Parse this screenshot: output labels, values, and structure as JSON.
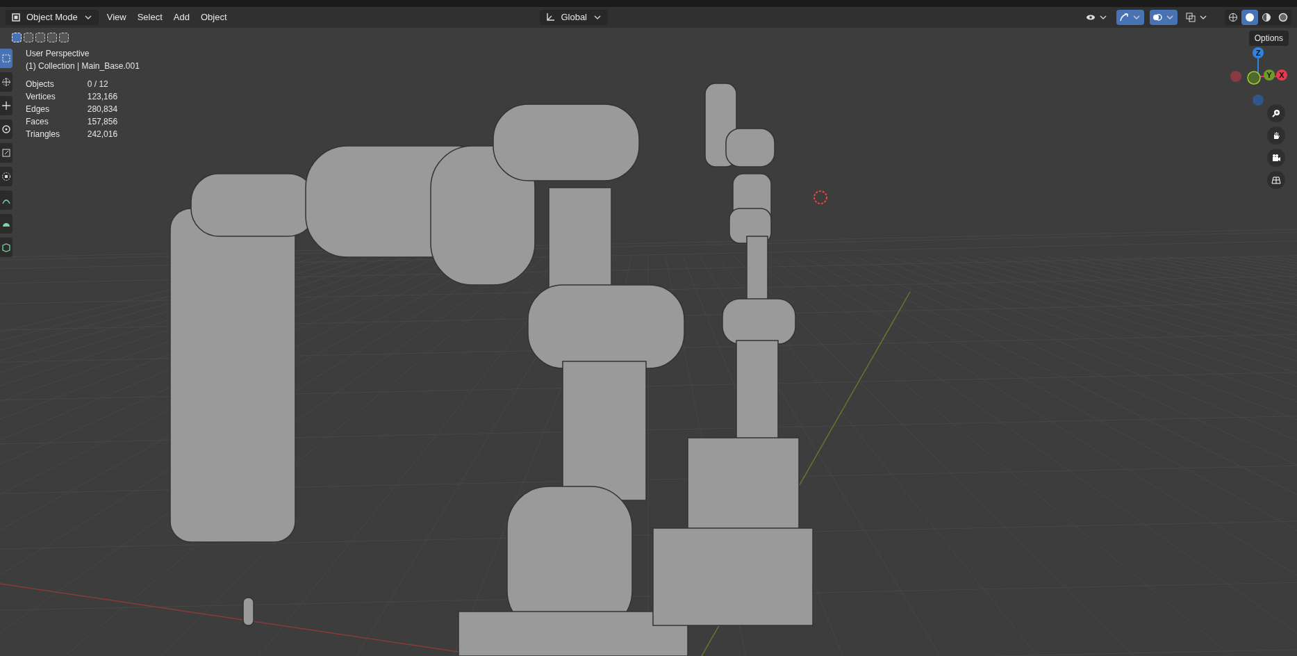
{
  "header": {
    "mode": "Object Mode",
    "menus": [
      "View",
      "Select",
      "Add",
      "Object"
    ],
    "orientation": "Global",
    "right_toggles": [
      {
        "kind": "visibility",
        "on": false
      },
      {
        "kind": "gizmo",
        "on": true
      },
      {
        "kind": "overlay",
        "on": true
      },
      {
        "kind": "xray",
        "on": false
      }
    ],
    "shading": [
      {
        "kind": "wireframe",
        "selected": false
      },
      {
        "kind": "solid",
        "selected": true
      },
      {
        "kind": "material",
        "selected": false
      },
      {
        "kind": "rendered",
        "selected": false
      }
    ]
  },
  "select_modes": [
    {
      "selected": true
    },
    {
      "selected": false
    },
    {
      "selected": false
    },
    {
      "selected": false
    },
    {
      "selected": false
    }
  ],
  "options": "Options",
  "tools": [
    {
      "kind": "select",
      "selected": true
    },
    {
      "kind": "cursor",
      "selected": false
    },
    {
      "kind": "move",
      "selected": false
    },
    {
      "kind": "rotate",
      "selected": false
    },
    {
      "kind": "scale",
      "selected": false
    },
    {
      "kind": "transform",
      "selected": false
    },
    {
      "kind": "annotate",
      "selected": false
    },
    {
      "kind": "measure",
      "selected": false
    },
    {
      "kind": "add-cube",
      "selected": false
    }
  ],
  "viewport": {
    "view_name": "User Perspective",
    "collection": "(1) Collection | Main_Base.001",
    "stats": [
      {
        "label": "Objects",
        "value": "0 / 12"
      },
      {
        "label": "Vertices",
        "value": "123,166"
      },
      {
        "label": "Edges",
        "value": "280,834"
      },
      {
        "label": "Faces",
        "value": "157,856"
      },
      {
        "label": "Triangles",
        "value": "242,016"
      }
    ]
  },
  "gizmo": {
    "axes": [
      {
        "label": "Z",
        "color": "#2f83e3"
      },
      {
        "label": "Y",
        "color": "#6e9a25"
      },
      {
        "label": "X",
        "color": "#e43a4f"
      }
    ]
  },
  "nav_buttons": [
    {
      "kind": "zoom"
    },
    {
      "kind": "pan"
    },
    {
      "kind": "camera"
    },
    {
      "kind": "ortho"
    }
  ]
}
